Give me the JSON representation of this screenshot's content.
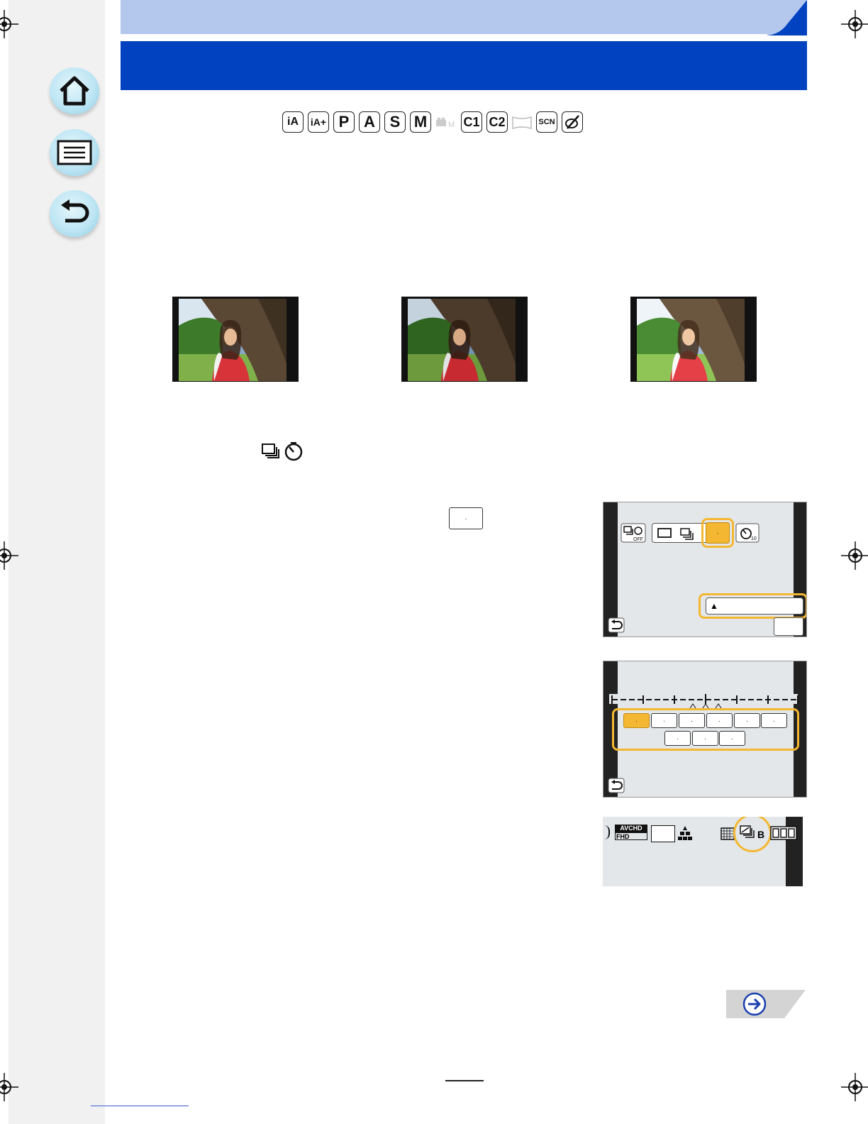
{
  "sidebar": {
    "buttons": [
      {
        "name": "home-icon"
      },
      {
        "name": "menu-list-icon"
      },
      {
        "name": "back-icon"
      }
    ]
  },
  "modes": [
    "iA",
    "iA+",
    "P",
    "A",
    "S",
    "M",
    "C1",
    "C2",
    "SCN"
  ],
  "bracket_box_label": "·",
  "drive_menu": {
    "selected_label": "·",
    "sub_option_arrow": "▲"
  },
  "bracket_step": {
    "options_row1": [
      "·",
      "·",
      "·",
      "·",
      "·",
      "·"
    ],
    "options_row2": [
      "·",
      "·",
      "·"
    ]
  },
  "status_bar": {
    "avchd": "AVCHD",
    "fhd": "FHD",
    "bracket_label": "B"
  },
  "colors": {
    "header_blue": "#0042c0",
    "header_light": "#b4c8ee",
    "highlight_orange": "#f4b731",
    "nav_button": "#bfe6f4"
  }
}
